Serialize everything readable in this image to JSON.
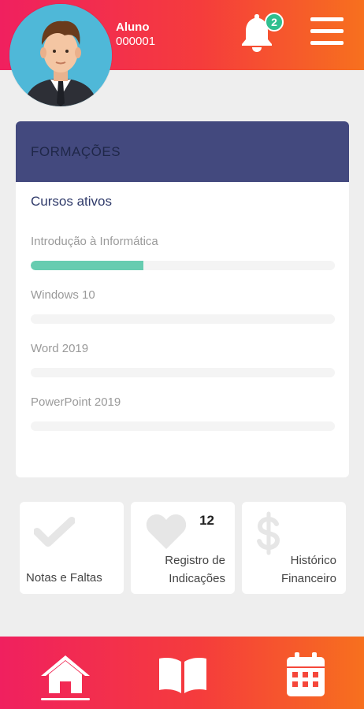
{
  "header": {
    "role": "Aluno",
    "user_id": "000001",
    "notification_count": "2"
  },
  "card": {
    "title": "FORMAÇÕES",
    "subtitle": "Cursos ativos",
    "courses": [
      {
        "name": "Introdução à Informática",
        "progress": 0.37
      },
      {
        "name": "Windows 10",
        "progress": 0
      },
      {
        "name": "Word 2019",
        "progress": 0
      },
      {
        "name": "PowerPoint 2019",
        "progress": 0
      }
    ]
  },
  "tiles": {
    "grades": {
      "label": "Notas e Faltas",
      "icon": "check-icon"
    },
    "referrals": {
      "label_line1": "Registro de",
      "label_line2": "Indicações",
      "count": "12",
      "icon": "heart-icon"
    },
    "financial": {
      "label_line1": "Histórico",
      "label_line2": "Financeiro",
      "icon": "dollar-icon"
    }
  },
  "nav": {
    "items": [
      {
        "icon": "home-icon",
        "active": true
      },
      {
        "icon": "book-icon",
        "active": false
      },
      {
        "icon": "calendar-icon",
        "active": false
      }
    ]
  },
  "colors": {
    "gradient_start": "#f0205f",
    "gradient_end": "#f7701e",
    "card_header": "#43497e",
    "progress_fill": "#66ccb0",
    "badge": "#2fbf8f"
  }
}
